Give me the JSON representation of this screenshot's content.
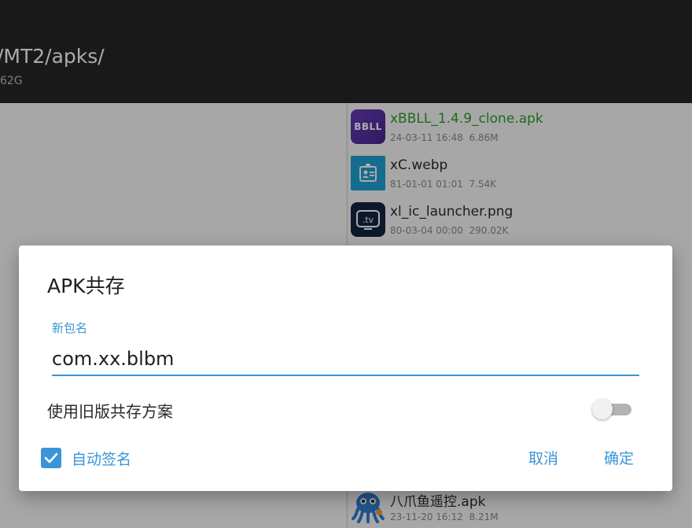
{
  "header": {
    "path": "/MT2/apks/",
    "storage": "62G"
  },
  "files": [
    {
      "name": "xBBLL_1.4.9_clone.apk",
      "date": "24-03-11 16:48",
      "size": "6.86M",
      "icon": "bbll-app-icon",
      "icon_text": "BBLL",
      "type": "apk"
    },
    {
      "name": "xC.webp",
      "date": "81-01-01 01:01",
      "size": "7.54K",
      "icon": "id-card-icon",
      "type": "image"
    },
    {
      "name": "xl_ic_launcher.png",
      "date": "80-03-04 00:00",
      "size": "290.02K",
      "icon": "tv-icon",
      "icon_text": ".tv",
      "type": "image"
    },
    {
      "name": "八爪鱼遥控.apk",
      "date": "23-11-20 16:12",
      "size": "8.21M",
      "icon": "octopus-icon",
      "type": "apk"
    }
  ],
  "dialog": {
    "title": "APK共存",
    "field_label": "新包名",
    "package_value": "com.xx.blbm",
    "legacy_toggle_label": "使用旧版共存方案",
    "legacy_toggle_on": false,
    "auto_sign_label": "自动签名",
    "auto_sign_checked": true,
    "cancel_label": "取消",
    "ok_label": "确定"
  },
  "colors": {
    "accent": "#3a95d8",
    "topbar": "#262626",
    "apk_name": "#2aa02a"
  }
}
